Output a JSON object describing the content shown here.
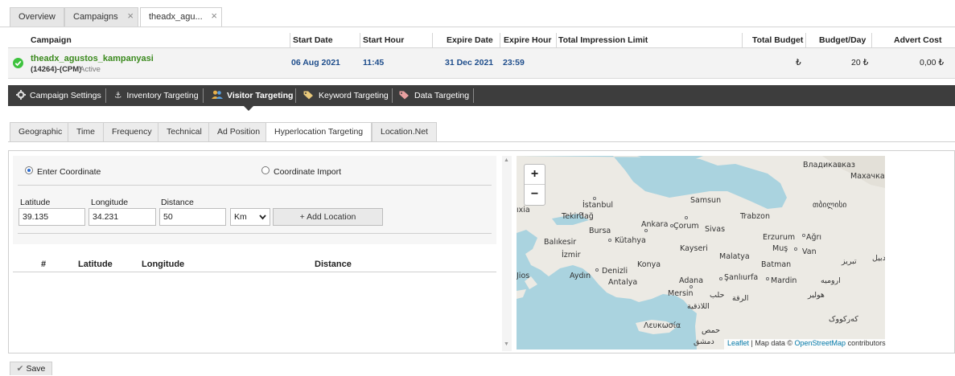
{
  "tabs": [
    {
      "label": "Overview"
    },
    {
      "label": "Campaigns"
    },
    {
      "label": "theadx_agu..."
    }
  ],
  "table": {
    "headers": [
      "Campaign",
      "Start Date",
      "Start Hour",
      "Expire Date",
      "Expire Hour",
      "Total Impression Limit",
      "Total Budget",
      "Budget/Day",
      "Advert Cost"
    ],
    "row": {
      "name": "theadx_agustos_kampanyasi",
      "id_type": "(14264)-(CPM)",
      "status": "Active",
      "start_date": "06 Aug 2021",
      "start_hour": "11:45",
      "expire_date": "31 Dec 2021",
      "expire_hour": "23:59",
      "impression_limit": "",
      "total_budget": "₺",
      "budget_day": "20 ₺",
      "advert_cost": "0,00 ₺"
    }
  },
  "nav": [
    {
      "label": "Campaign Settings",
      "icon": "gear-icon"
    },
    {
      "label": "Inventory Targeting",
      "icon": "anchor-icon"
    },
    {
      "label": "Visitor Targeting",
      "icon": "users-icon"
    },
    {
      "label": "Keyword Targeting",
      "icon": "tag-icon"
    },
    {
      "label": "Data Targeting",
      "icon": "tag-icon"
    }
  ],
  "subtabs": [
    "Geographic",
    "Time",
    "Frequency",
    "Technical",
    "Ad Position",
    "Hyperlocation Targeting",
    "Location.Net"
  ],
  "form": {
    "radio_enter": "Enter Coordinate",
    "radio_import": "Coordinate Import",
    "latitude_label": "Latitude",
    "longitude_label": "Longitude",
    "distance_label": "Distance",
    "latitude_value": "39.135",
    "longitude_value": "34.231",
    "distance_value": "50",
    "unit": "Km",
    "add_button": "+ Add Location"
  },
  "list_headers": [
    "#",
    "Latitude",
    "Longitude",
    "Distance"
  ],
  "map": {
    "zoom_in": "+",
    "zoom_out": "−",
    "cities": [
      {
        "name": "Владикавказ"
      },
      {
        "name": "Махачкал"
      },
      {
        "name": "İstanbul"
      },
      {
        "name": "Samsun"
      },
      {
        "name": "თბილისი"
      },
      {
        "name": "Tekirdağ"
      },
      {
        "name": "Trabzon"
      },
      {
        "name": "Ankara"
      },
      {
        "name": "Çorum"
      },
      {
        "name": "Sivas"
      },
      {
        "name": "Bursa"
      },
      {
        "name": "Erzurum"
      },
      {
        "name": "Ağrı"
      },
      {
        "name": "Balıkesir"
      },
      {
        "name": "Kütahya"
      },
      {
        "name": "Kayseri"
      },
      {
        "name": "Muş"
      },
      {
        "name": "İzmir"
      },
      {
        "name": "Malatya"
      },
      {
        "name": "Van"
      },
      {
        "name": "تبریز"
      },
      {
        "name": "اردبیل"
      },
      {
        "name": "Konya"
      },
      {
        "name": "Batman"
      },
      {
        "name": "Denizli"
      },
      {
        "name": "Aydın"
      },
      {
        "name": "Antalya"
      },
      {
        "name": "Adana"
      },
      {
        "name": "Şanlıurfa"
      },
      {
        "name": "Mardin"
      },
      {
        "name": "ارومیه"
      },
      {
        "name": "Mersin"
      },
      {
        "name": "حلب"
      },
      {
        "name": "الرقة"
      },
      {
        "name": "اللاذقية"
      },
      {
        "name": "هولير"
      },
      {
        "name": "Λευκωσία"
      },
      {
        "name": "حمص"
      },
      {
        "name": "دمشق"
      },
      {
        "name": "کەرکووک"
      },
      {
        "name": "ıxia"
      },
      {
        "name": "Jios"
      }
    ],
    "attribution_leaflet": "Leaflet",
    "attribution_text": " | Map data © ",
    "attribution_osm": "OpenStreetMap",
    "attribution_tail": " contributors"
  },
  "save_button": "Save",
  "colors": {
    "accent": "#1f4e8c",
    "navbar": "#3d3d3d",
    "campaign_name": "#3b8a1e",
    "active_check": "#3ec33e"
  }
}
